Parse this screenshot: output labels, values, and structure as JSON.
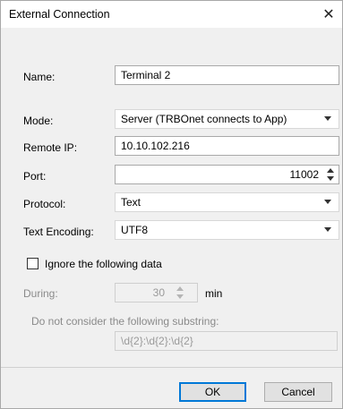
{
  "window": {
    "title": "External Connection",
    "close_glyph": "✕"
  },
  "form": {
    "name_label": "Name:",
    "name_value": "Terminal 2",
    "mode_label": "Mode:",
    "mode_value": "Server (TRBOnet connects to App)",
    "remote_ip_label": "Remote IP:",
    "remote_ip_value": "10.10.102.216",
    "port_label": "Port:",
    "port_value": "11002",
    "protocol_label": "Protocol:",
    "protocol_value": "Text",
    "encoding_label": "Text Encoding:",
    "encoding_value": "UTF8",
    "ignore_label": "Ignore the following data",
    "ignore_checked": false,
    "during_label": "During:",
    "during_value": "30",
    "during_unit": "min",
    "substring_label": "Do not consider the following substring:",
    "substring_value": "\\d{2}:\\d{2}:\\d{2}"
  },
  "buttons": {
    "ok": "OK",
    "cancel": "Cancel"
  },
  "colors": {
    "accent": "#0078d7",
    "dialog_bg": "#f0f0f0",
    "disabled_text": "#8a8a8a"
  },
  "icons": [
    "close-icon",
    "dropdown-arrow-icon",
    "spin-up-icon",
    "spin-down-icon"
  ]
}
